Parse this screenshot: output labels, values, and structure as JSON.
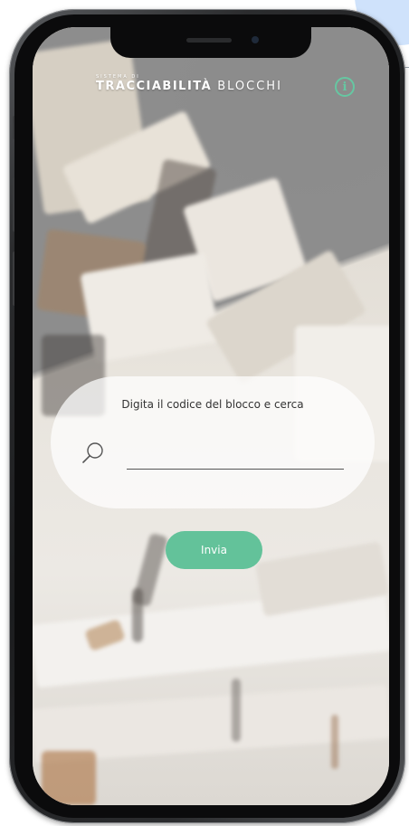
{
  "header": {
    "brand_small": "SISTEMA DI",
    "brand_strong": "TRACCIABILITÀ",
    "brand_light": "BLOCCHI",
    "info_icon": "info-icon"
  },
  "search": {
    "hint": "Digita il codice del blocco e cerca",
    "icon": "search-icon",
    "value": "",
    "placeholder": ""
  },
  "submit": {
    "label": "Invia"
  },
  "colors": {
    "accent": "#63c29a",
    "info": "#66c7a2"
  }
}
